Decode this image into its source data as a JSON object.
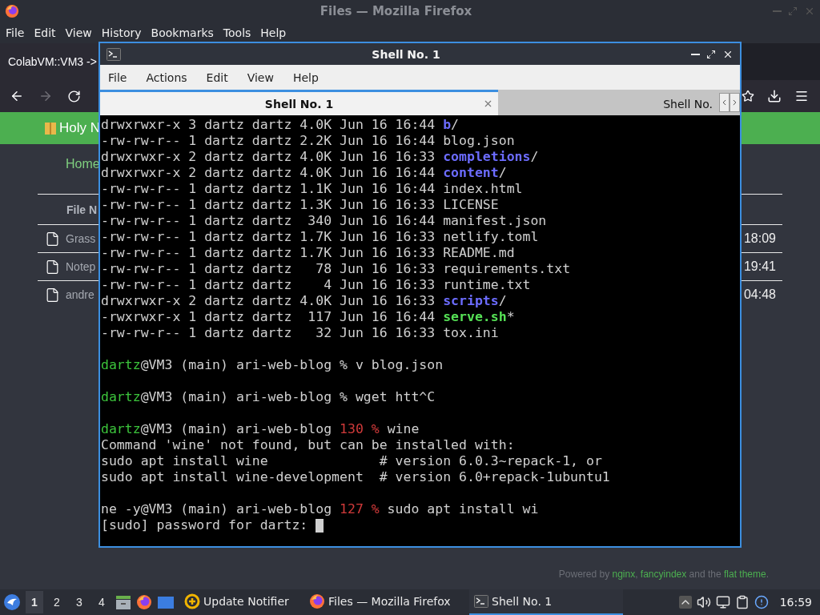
{
  "browser": {
    "title": "Files — Mozilla Firefox",
    "menu": [
      "File",
      "Edit",
      "View",
      "History",
      "Bookmarks",
      "Tools",
      "Help"
    ],
    "tab": {
      "label": "ColabVM::VM3 ->"
    },
    "page": {
      "header": "Holy N",
      "breadcrumb": "Home",
      "table": {
        "columns": [
          "File N"
        ],
        "rows": [
          {
            "name": "Grass",
            "time": "18:09"
          },
          {
            "name": "Notep",
            "time": "19:41"
          },
          {
            "name": "andre",
            "time": "04:48"
          }
        ]
      },
      "footer": [
        {
          "text": "Powered by ",
          "kind": "plain"
        },
        {
          "text": "nginx",
          "kind": "link"
        },
        {
          "text": ", ",
          "kind": "plain"
        },
        {
          "text": "fancyindex",
          "kind": "link"
        },
        {
          "text": " and the ",
          "kind": "plain"
        },
        {
          "text": "flat theme",
          "kind": "link"
        },
        {
          "text": ".",
          "kind": "plain"
        }
      ]
    }
  },
  "terminal": {
    "title": "Shell No. 1",
    "menu": [
      "File",
      "Actions",
      "Edit",
      "View",
      "Help"
    ],
    "tabs": [
      {
        "label": "Shell No. 1",
        "selected": true
      },
      {
        "label": "Shell No.",
        "selected": false
      }
    ],
    "lines": [
      {
        "kind": "text",
        "segments": [
          {
            "text": "drwxrwxr-x 3 dartz dartz 4.0K Jun 16 16:44 ",
            "kind": "plain"
          },
          {
            "text": "b",
            "kind": "dir"
          },
          {
            "text": "/",
            "kind": "plain"
          }
        ]
      },
      {
        "kind": "text",
        "segments": [
          {
            "text": "-rw-rw-r-- 1 dartz dartz 2.2K Jun 16 16:44 blog.json",
            "kind": "plain"
          }
        ]
      },
      {
        "kind": "text",
        "segments": [
          {
            "text": "drwxrwxr-x 2 dartz dartz 4.0K Jun 16 16:33 ",
            "kind": "plain"
          },
          {
            "text": "completions",
            "kind": "dir"
          },
          {
            "text": "/",
            "kind": "plain"
          }
        ]
      },
      {
        "kind": "text",
        "segments": [
          {
            "text": "drwxrwxr-x 2 dartz dartz 4.0K Jun 16 16:44 ",
            "kind": "plain"
          },
          {
            "text": "content",
            "kind": "dir"
          },
          {
            "text": "/",
            "kind": "plain"
          }
        ]
      },
      {
        "kind": "text",
        "segments": [
          {
            "text": "-rw-rw-r-- 1 dartz dartz 1.1K Jun 16 16:44 index.html",
            "kind": "plain"
          }
        ]
      },
      {
        "kind": "text",
        "segments": [
          {
            "text": "-rw-rw-r-- 1 dartz dartz 1.3K Jun 16 16:33 LICENSE",
            "kind": "plain"
          }
        ]
      },
      {
        "kind": "text",
        "segments": [
          {
            "text": "-rw-rw-r-- 1 dartz dartz  340 Jun 16 16:44 manifest.json",
            "kind": "plain"
          }
        ]
      },
      {
        "kind": "text",
        "segments": [
          {
            "text": "-rw-rw-r-- 1 dartz dartz 1.7K Jun 16 16:33 netlify.toml",
            "kind": "plain"
          }
        ]
      },
      {
        "kind": "text",
        "segments": [
          {
            "text": "-rw-rw-r-- 1 dartz dartz 1.7K Jun 16 16:33 README.md",
            "kind": "plain"
          }
        ]
      },
      {
        "kind": "text",
        "segments": [
          {
            "text": "-rw-rw-r-- 1 dartz dartz   78 Jun 16 16:33 requirements.txt",
            "kind": "plain"
          }
        ]
      },
      {
        "kind": "text",
        "segments": [
          {
            "text": "-rw-rw-r-- 1 dartz dartz    4 Jun 16 16:33 runtime.txt",
            "kind": "plain"
          }
        ]
      },
      {
        "kind": "text",
        "segments": [
          {
            "text": "drwxrwxr-x 2 dartz dartz 4.0K Jun 16 16:33 ",
            "kind": "plain"
          },
          {
            "text": "scripts",
            "kind": "dir"
          },
          {
            "text": "/",
            "kind": "plain"
          }
        ]
      },
      {
        "kind": "text",
        "segments": [
          {
            "text": "-rwxrwxr-x 1 dartz dartz  117 Jun 16 16:44 ",
            "kind": "plain"
          },
          {
            "text": "serve.sh",
            "kind": "exec"
          },
          {
            "text": "*",
            "kind": "plain"
          }
        ]
      },
      {
        "kind": "text",
        "segments": [
          {
            "text": "-rw-rw-r-- 1 dartz dartz   32 Jun 16 16:33 tox.ini",
            "kind": "plain"
          }
        ]
      },
      {
        "kind": "blank"
      },
      {
        "kind": "text",
        "segments": [
          {
            "text": "dartz",
            "kind": "user"
          },
          {
            "text": "@VM3 (main) ari-web-blog % v blog.json",
            "kind": "plain"
          }
        ]
      },
      {
        "kind": "blank"
      },
      {
        "kind": "text",
        "segments": [
          {
            "text": "dartz",
            "kind": "user"
          },
          {
            "text": "@VM3 (main) ari-web-blog % wget htt^C",
            "kind": "plain"
          }
        ]
      },
      {
        "kind": "blank"
      },
      {
        "kind": "text",
        "segments": [
          {
            "text": "dartz",
            "kind": "user"
          },
          {
            "text": "@VM3 (main) ari-web-blog ",
            "kind": "plain"
          },
          {
            "text": "130 %",
            "kind": "error"
          },
          {
            "text": " wine",
            "kind": "plain"
          }
        ]
      },
      {
        "kind": "text",
        "segments": [
          {
            "text": "Command 'wine' not found, but can be installed with:",
            "kind": "plain"
          }
        ]
      },
      {
        "kind": "text",
        "segments": [
          {
            "text": "sudo apt install wine              # version 6.0.3~repack-1, or",
            "kind": "plain"
          }
        ]
      },
      {
        "kind": "text",
        "segments": [
          {
            "text": "sudo apt install wine-development  # version 6.0+repack-1ubuntu1",
            "kind": "plain"
          }
        ]
      },
      {
        "kind": "blank"
      },
      {
        "kind": "text",
        "segments": [
          {
            "text": "ne -y@VM3 (main) ari-web-blog ",
            "kind": "plain"
          },
          {
            "text": "127 %",
            "kind": "error"
          },
          {
            "text": " sudo apt install wi",
            "kind": "plain"
          }
        ]
      },
      {
        "kind": "input",
        "segments": [
          {
            "text": "[sudo] password for dartz: ",
            "kind": "plain"
          }
        ]
      }
    ]
  },
  "taskbar": {
    "workspaces": [
      {
        "label": "1",
        "selected": true
      },
      {
        "label": "2",
        "selected": false
      },
      {
        "label": "3",
        "selected": false
      },
      {
        "label": "4",
        "selected": false
      }
    ],
    "tasks": [
      {
        "label": "Update Notifier",
        "kind": "notifier",
        "selected": false
      },
      {
        "label": "Files — Mozilla Firefox",
        "kind": "browser",
        "selected": false
      },
      {
        "label": "Shell No. 1",
        "kind": "terminal",
        "selected": true
      }
    ],
    "clock": "16:59"
  }
}
